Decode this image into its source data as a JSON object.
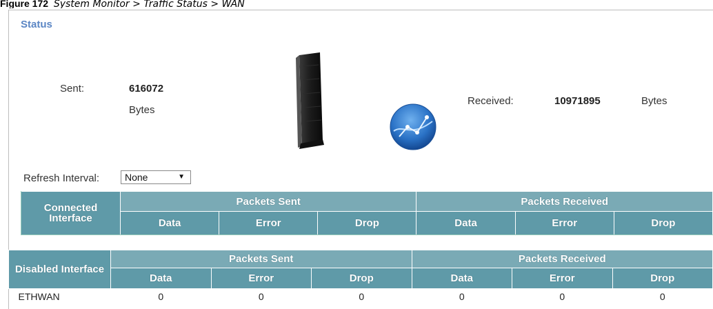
{
  "caption": {
    "figure": "Figure 172",
    "text": "System Monitor > Traffic Status > WAN"
  },
  "status": {
    "title": "Status"
  },
  "sent": {
    "label": "Sent:",
    "value": "616072",
    "unit": "Bytes"
  },
  "received": {
    "label": "Received:",
    "value": "10971895",
    "unit": "Bytes"
  },
  "refresh": {
    "label": "Refresh Interval:",
    "value": "None"
  },
  "connected_table": {
    "side_header": "Connected Interface",
    "group_sent": "Packets Sent",
    "group_received": "Packets Received",
    "cols": [
      "Data",
      "Error",
      "Drop",
      "Data",
      "Error",
      "Drop"
    ]
  },
  "disabled_table": {
    "side_header": "Disabled Interface",
    "group_sent": "Packets Sent",
    "group_received": "Packets Received",
    "cols": [
      "Data",
      "Error",
      "Drop",
      "Data",
      "Error",
      "Drop"
    ],
    "rows": [
      {
        "name": "ETHWAN",
        "cells": [
          "0",
          "0",
          "0",
          "0",
          "0",
          "0"
        ]
      }
    ]
  },
  "colors": {
    "title": "#5b86c4",
    "header_bg": "#5f9aa8",
    "header_group_bg": "#7aaab5"
  },
  "icons": {
    "device": "router-icon",
    "globe": "globe-icon"
  }
}
